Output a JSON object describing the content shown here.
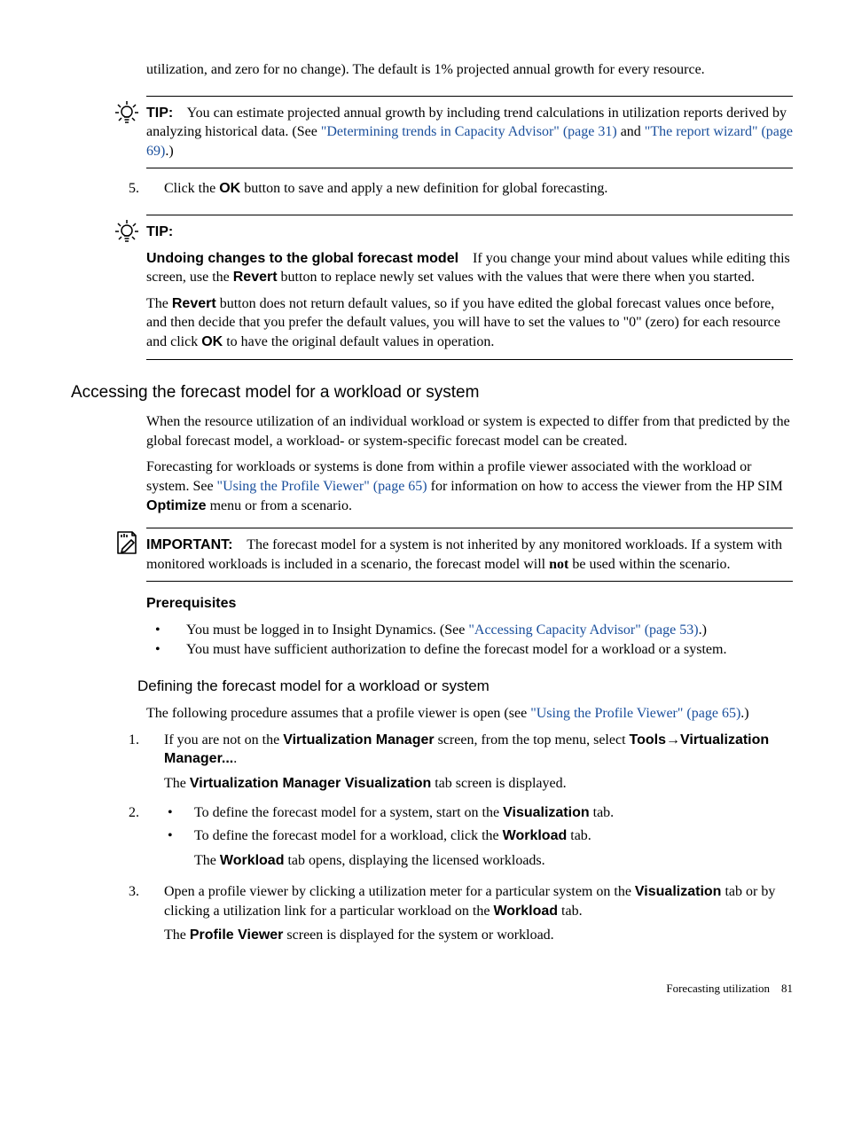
{
  "intro_cont": "utilization, and zero for no change). The default is 1% projected annual growth for every resource.",
  "tip1": {
    "label": "TIP:",
    "body_a": "You can estimate projected annual growth by including trend calculations in utilization reports derived by analyzing historical data. (See ",
    "link1": "\"Determining trends in Capacity Advisor\" (page 31)",
    "mid": " and ",
    "link2": "\"The report wizard\" (page 69)",
    "tail": ".)"
  },
  "step5": {
    "num": "5.",
    "a": "Click the ",
    "ok": "OK",
    "b": " button to save and apply a new definition for global forecasting."
  },
  "tip2": {
    "label": "TIP:",
    "heading": "Undoing changes to the global forecast model",
    "p1a": "If you change your mind about values while editing this screen, use the ",
    "revert": "Revert",
    "p1b": " button to replace newly set values with the values that were there when you started.",
    "p2a": "The ",
    "p2b": " button does not return default values, so if you have edited the global forecast values once before, and then decide that you prefer the default values, you will have to set the values to \"0\" (zero) for each resource and click ",
    "ok": "OK",
    "p2c": " to have the original default values in operation."
  },
  "section_heading": "Accessing the forecast model for a workload or system",
  "s_p1": "When the resource utilization of an individual workload or system is expected to differ from that predicted by the global forecast model, a workload- or system-specific forecast model can be created.",
  "s_p2a": "Forecasting for workloads or systems is done from within a profile viewer associated with the workload or system. See ",
  "s_p2_link": "\"Using the Profile Viewer\" (page 65)",
  "s_p2b": " for information on how to access the viewer from the HP SIM ",
  "s_p2_optimize": "Optimize",
  "s_p2c": " menu or from a scenario.",
  "important": {
    "label": "IMPORTANT:",
    "a": "The forecast model for a system is not inherited by any monitored workloads. If a system with monitored workloads is included in a scenario, the forecast model will ",
    "not": "not",
    "b": " be used within the scenario."
  },
  "prereq_heading": "Prerequisites",
  "prereq1a": "You must be logged in to Insight Dynamics. (See ",
  "prereq1_link": "\"Accessing Capacity Advisor\" (page 53)",
  "prereq1b": ".)",
  "prereq2": "You must have sufficient authorization to define the forecast model for a workload or a system.",
  "subsection_heading": "Defining the forecast model for a workload or system",
  "def_intro_a": "The following procedure assumes that a profile viewer is open (see ",
  "def_intro_link": "\"Using the Profile Viewer\" (page 65)",
  "def_intro_b": ".)",
  "proc": {
    "s1": {
      "num": "1.",
      "a": "If you are not on the ",
      "vm": "Virtualization Manager",
      "b": " screen, from the top menu, select ",
      "tools": "Tools",
      "arrow": "→",
      "vmmenu": "Virtualization Manager...",
      "dot": ".",
      "result_a": "The ",
      "result_vmv": "Virtualization Manager Visualization",
      "result_b": " tab screen is displayed."
    },
    "s2": {
      "num": "2.",
      "b1a": "To define the forecast model for a system, start on the ",
      "b1_vis": "Visualization",
      "b1b": " tab.",
      "b2a": "To define the forecast model for a workload, click the ",
      "b2_wl": "Workload",
      "b2b": " tab.",
      "res_a": "The ",
      "res_wl": "Workload",
      "res_b": " tab opens, displaying the licensed workloads."
    },
    "s3": {
      "num": "3.",
      "a": "Open a profile viewer by clicking a utilization meter for a particular system on the ",
      "vis": "Visualization",
      "b": " tab or by clicking a utilization link for a particular workload on the ",
      "wl": "Workload",
      "c": " tab.",
      "res_a": "The ",
      "res_pv": "Profile Viewer",
      "res_b": " screen is displayed for the system or workload."
    }
  },
  "footer_text": "Forecasting utilization",
  "footer_page": "81"
}
